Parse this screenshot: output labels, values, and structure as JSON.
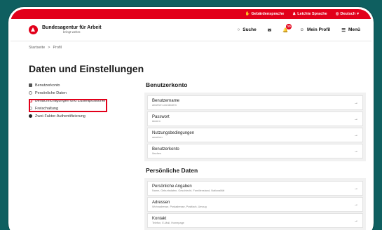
{
  "topbar": {
    "items": [
      {
        "icon": "sign-language-icon",
        "label": "Gebärdensprache"
      },
      {
        "icon": "person-icon",
        "label": "Leichte Sprache"
      },
      {
        "icon": "globe-icon",
        "label": "Deutsch"
      }
    ],
    "bg": "#e2001a"
  },
  "header": {
    "brand_title": "Bundesagentur für Arbeit",
    "brand_sub": "bringt weiter.",
    "search_label": "Suche",
    "notification_count": "10",
    "profile_label": "Mein Profil",
    "menu_label": "Menü"
  },
  "breadcrumb": {
    "home": "Startseite",
    "sep": ">",
    "current": "Profil"
  },
  "page_title": "Daten und Einstellungen",
  "sidebar": {
    "items": [
      {
        "label": "Benutzerkonto",
        "icon": "lock-icon"
      },
      {
        "label": "Persönliche Daten",
        "icon": "person-icon"
      },
      {
        "label": "Benachrichtigungen und Zustellpositionen",
        "icon": "document-icon"
      },
      {
        "label": "Freischaltung",
        "icon": "key-icon"
      },
      {
        "label": "Zwei-Faktor-Authentifizierung",
        "icon": "shield-icon"
      }
    ]
  },
  "sections": [
    {
      "title": "Benutzerkonto",
      "cards": [
        {
          "title": "Benutzername",
          "sub": "ansehen und ändern"
        },
        {
          "title": "Passwort",
          "sub": "ändern"
        },
        {
          "title": "Nutzungsbedingungen",
          "sub": "ansehen"
        },
        {
          "title": "Benutzerkonto",
          "sub": "löschen"
        }
      ]
    },
    {
      "title": "Persönliche Daten",
      "cards": [
        {
          "title": "Persönliche Angaben",
          "sub": "Name, Geburtsdaten, Geschlecht, Familienstand, Nationalität"
        },
        {
          "title": "Adressen",
          "sub": "Wohnadresse, Postadresse, Postfach, Umzug"
        },
        {
          "title": "Kontakt",
          "sub": "Telefon, E-Mail, Homepage"
        }
      ]
    }
  ],
  "arrow": "→"
}
